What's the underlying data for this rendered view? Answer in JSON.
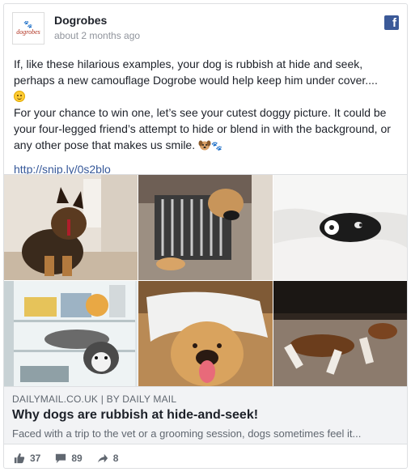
{
  "post": {
    "page_name": "Dogrobes",
    "avatar_text": "dogrobes",
    "timestamp": "about 2 months ago",
    "platform_icon": "facebook-icon",
    "paragraph1": "If, like these hilarious examples, your dog is rubbish at hide and seek, perhaps a new camouflage Dogrobe would help keep him under cover....",
    "paragraph2": "For your chance to win one, let’s see your cutest doggy picture. It could be your four-legged friend’s attempt to hide or blend in with the background, or any other pose that makes us smile.",
    "link": "http://snip.ly/0s2blo"
  },
  "photos": [
    {
      "name": "photo-dog-behind-paper"
    },
    {
      "name": "photo-dog-in-radiator"
    },
    {
      "name": "photo-dog-under-pillows"
    },
    {
      "name": "photo-husky-in-fridge"
    },
    {
      "name": "photo-golden-retriever-under-blanket"
    },
    {
      "name": "photo-dog-under-couch"
    }
  ],
  "link_preview": {
    "source": "DAILYMAIL.CO.UK",
    "separator": "|",
    "by": "BY DAILY MAIL",
    "headline": "Why dogs are rubbish at hide-and-seek!",
    "description": "Faced with a trip to the vet or a grooming session, dogs sometimes feel it..."
  },
  "stats": {
    "likes": "37",
    "comments": "89",
    "shares": "8"
  },
  "colors": {
    "facebook_blue": "#3b5998",
    "link_blue": "#365899",
    "meta_gray": "#90949c"
  }
}
